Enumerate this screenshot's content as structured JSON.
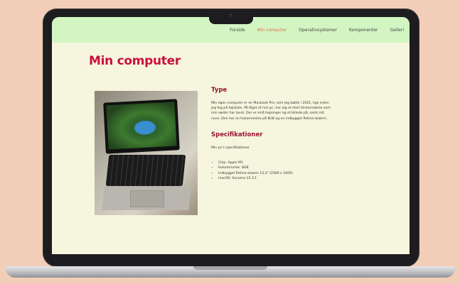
{
  "nav": {
    "items": [
      {
        "label": "Forside",
        "active": false
      },
      {
        "label": "Min computer",
        "active": true
      },
      {
        "label": "Operativsystemer",
        "active": false
      },
      {
        "label": "Komponenter",
        "active": false
      },
      {
        "label": "Galleri",
        "active": false
      }
    ],
    "background": "#d3f5c2",
    "active_color": "#e06a52"
  },
  "page": {
    "title": "Min computer",
    "title_color": "#c8103c",
    "background": "#f6f5dd"
  },
  "sections": {
    "type": {
      "heading": "Type",
      "text": "Min egen computer er en Macbook Pro, som jeg købte i 2021, lige inden jeg fog på højskole. På låget af min pc, har jeg et stort klistermærke som min søster har lavet. Der er små tegninger og et billede på, samt mit navn. Den har en hukommelse på 8GB og en indbygget Retina-skærm."
    },
    "specs": {
      "heading": "Specifikationer",
      "intro": "Min pc's specifikationer",
      "items": [
        "Chip: Apple M1",
        "Hukommelse: 8GB",
        "Indbygget Retina-skærm 13,3\" (2560 x 1600)",
        "macOS: Sonoma 15.3.1"
      ]
    }
  },
  "image": {
    "icon": "photo-of-macbook"
  }
}
